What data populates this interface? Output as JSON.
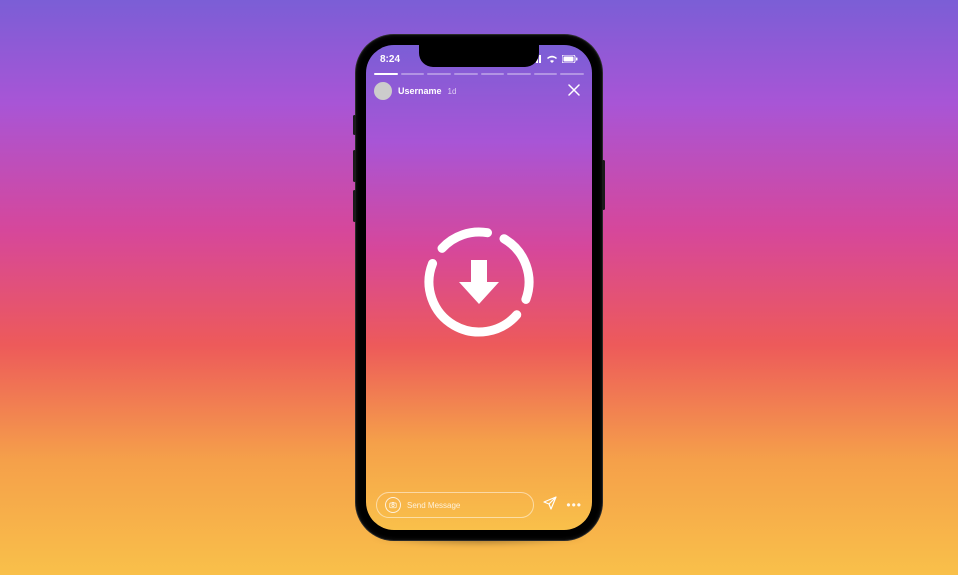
{
  "status": {
    "time": "8:24"
  },
  "story": {
    "username": "Username",
    "timestamp": "1d",
    "message_placeholder": "Send Message"
  },
  "icons": {
    "close": "close-icon",
    "download": "download-arrow-icon",
    "camera": "camera-icon",
    "send": "send-icon",
    "more": "more-icon",
    "signal": "signal-icon",
    "wifi": "wifi-icon",
    "battery": "battery-icon"
  }
}
